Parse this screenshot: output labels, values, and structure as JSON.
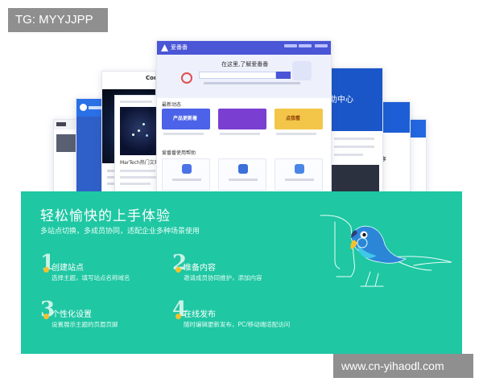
{
  "watermark_tag": "TG: MYYJJPP",
  "watermark_url": "www.cn-yihaodl.com",
  "mockups": {
    "convert_card_text": "Conv",
    "main_card_brand": "爱番番",
    "main_hero_title": "在这里,了解爱番番",
    "main_section_label": "最新动态",
    "main_banner_1": "产品更新着",
    "main_banner_2": "",
    "main_banner_3": "点我看",
    "main_section_label_2": "爱番番使用帮助",
    "help_center_text": "助中心",
    "right_card_text": "序",
    "list_card_text": "MarTech热门文章"
  },
  "panel": {
    "title": "轻松愉快的上手体验",
    "subtitle": "多站点切换，多成员协同，适配企业多种场景使用",
    "features": [
      {
        "num": "1",
        "name": "创建站点",
        "desc": "选择主题，填写站点名称域名"
      },
      {
        "num": "2",
        "name": "准备内容",
        "desc": "邀请成员协同维护，添加内容"
      },
      {
        "num": "3",
        "name": "个性化设置",
        "desc": "设置展示主题的页眉页脚"
      },
      {
        "num": "4",
        "name": "在线发布",
        "desc": "随时编辑更新发布，PC/移动端适配访问"
      }
    ]
  },
  "colors": {
    "panel_green": "#1fc7a3",
    "accent_yellow": "#f2c12e",
    "nav_indigo": "#4a56d6",
    "help_blue": "#1a56c7"
  }
}
